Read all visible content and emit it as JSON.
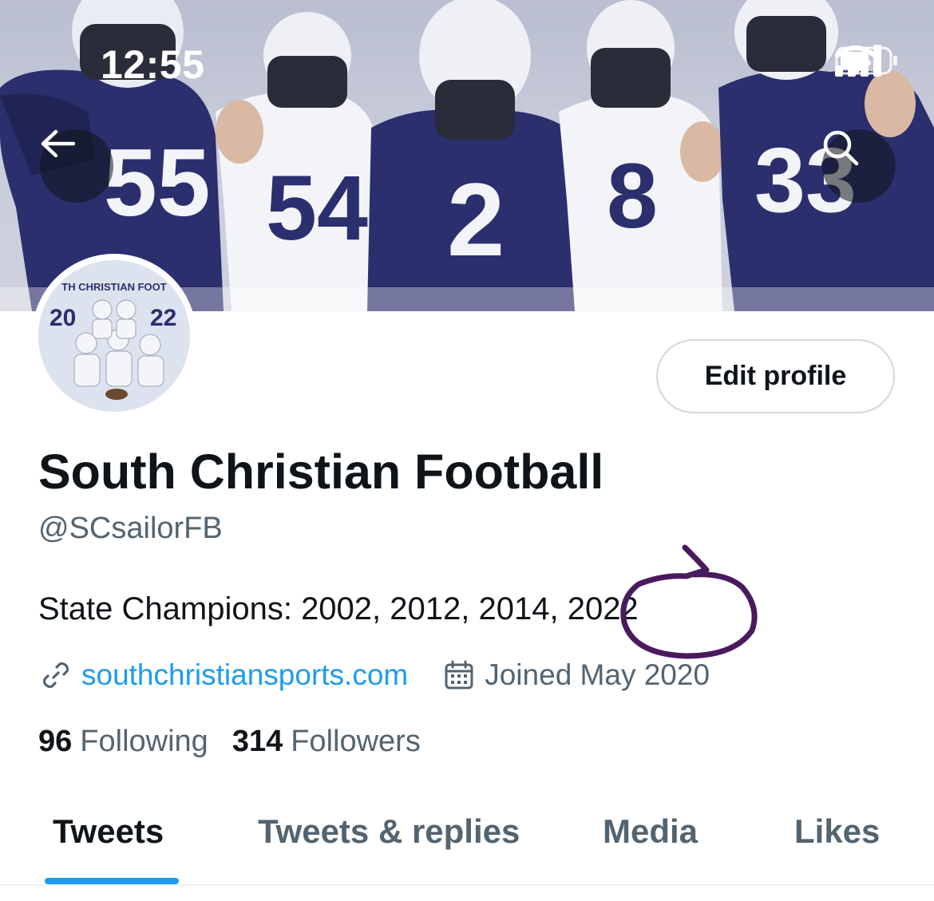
{
  "status_bar": {
    "time": "12:55",
    "icons": [
      "signal-icon",
      "wifi-icon",
      "battery-icon"
    ]
  },
  "header": {
    "back_icon": "back-arrow-icon",
    "search_icon": "search-icon",
    "banner_jersey_numbers": [
      "55",
      "54",
      "2",
      "8",
      "33"
    ]
  },
  "avatar": {
    "text_top": "TH CHRISTIAN FOOT",
    "text_left": "20",
    "text_right": "22"
  },
  "profile": {
    "edit_profile_label": "Edit profile",
    "display_name": "South Christian Football",
    "handle": "@SCsailorFB",
    "bio": "State Champions: 2002, 2012, 2014, 2022",
    "website": "southchristiansports.com",
    "joined": "Joined May 2020",
    "following_count": "96",
    "following_label": "Following",
    "followers_count": "314",
    "followers_label": "Followers"
  },
  "tabs": [
    {
      "label": "Tweets",
      "active": true
    },
    {
      "label": "Tweets & replies",
      "active": false
    },
    {
      "label": "Media",
      "active": false
    },
    {
      "label": "Likes",
      "active": false
    }
  ],
  "colors": {
    "accent": "#1d9bf0",
    "text_primary": "#0f1419",
    "text_secondary": "#536471",
    "annotation": "#4a1a5e",
    "jersey_navy": "#2b2f6e"
  }
}
